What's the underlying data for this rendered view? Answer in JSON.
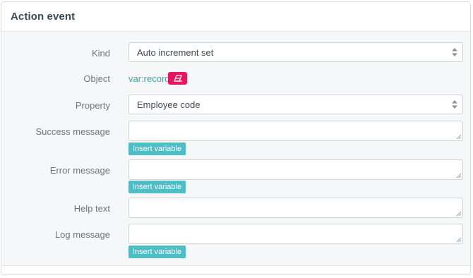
{
  "panel": {
    "title": "Action event"
  },
  "form": {
    "kind": {
      "label": "Kind",
      "value": "Auto increment set"
    },
    "object": {
      "label": "Object",
      "value": "var:record",
      "clear_icon": "eraser-icon"
    },
    "property": {
      "label": "Property",
      "value": "Employee code"
    },
    "success_message": {
      "label": "Success message",
      "value": "",
      "insert_label": "Insert variable"
    },
    "error_message": {
      "label": "Error message",
      "value": "",
      "insert_label": "Insert variable"
    },
    "help_text": {
      "label": "Help text",
      "value": ""
    },
    "log_message": {
      "label": "Log message",
      "value": "",
      "insert_label": "Insert variable"
    }
  },
  "colors": {
    "accent": "#4fbdc4",
    "link": "#3aa6ae",
    "danger": "#e8175d",
    "label": "#6c757d"
  }
}
